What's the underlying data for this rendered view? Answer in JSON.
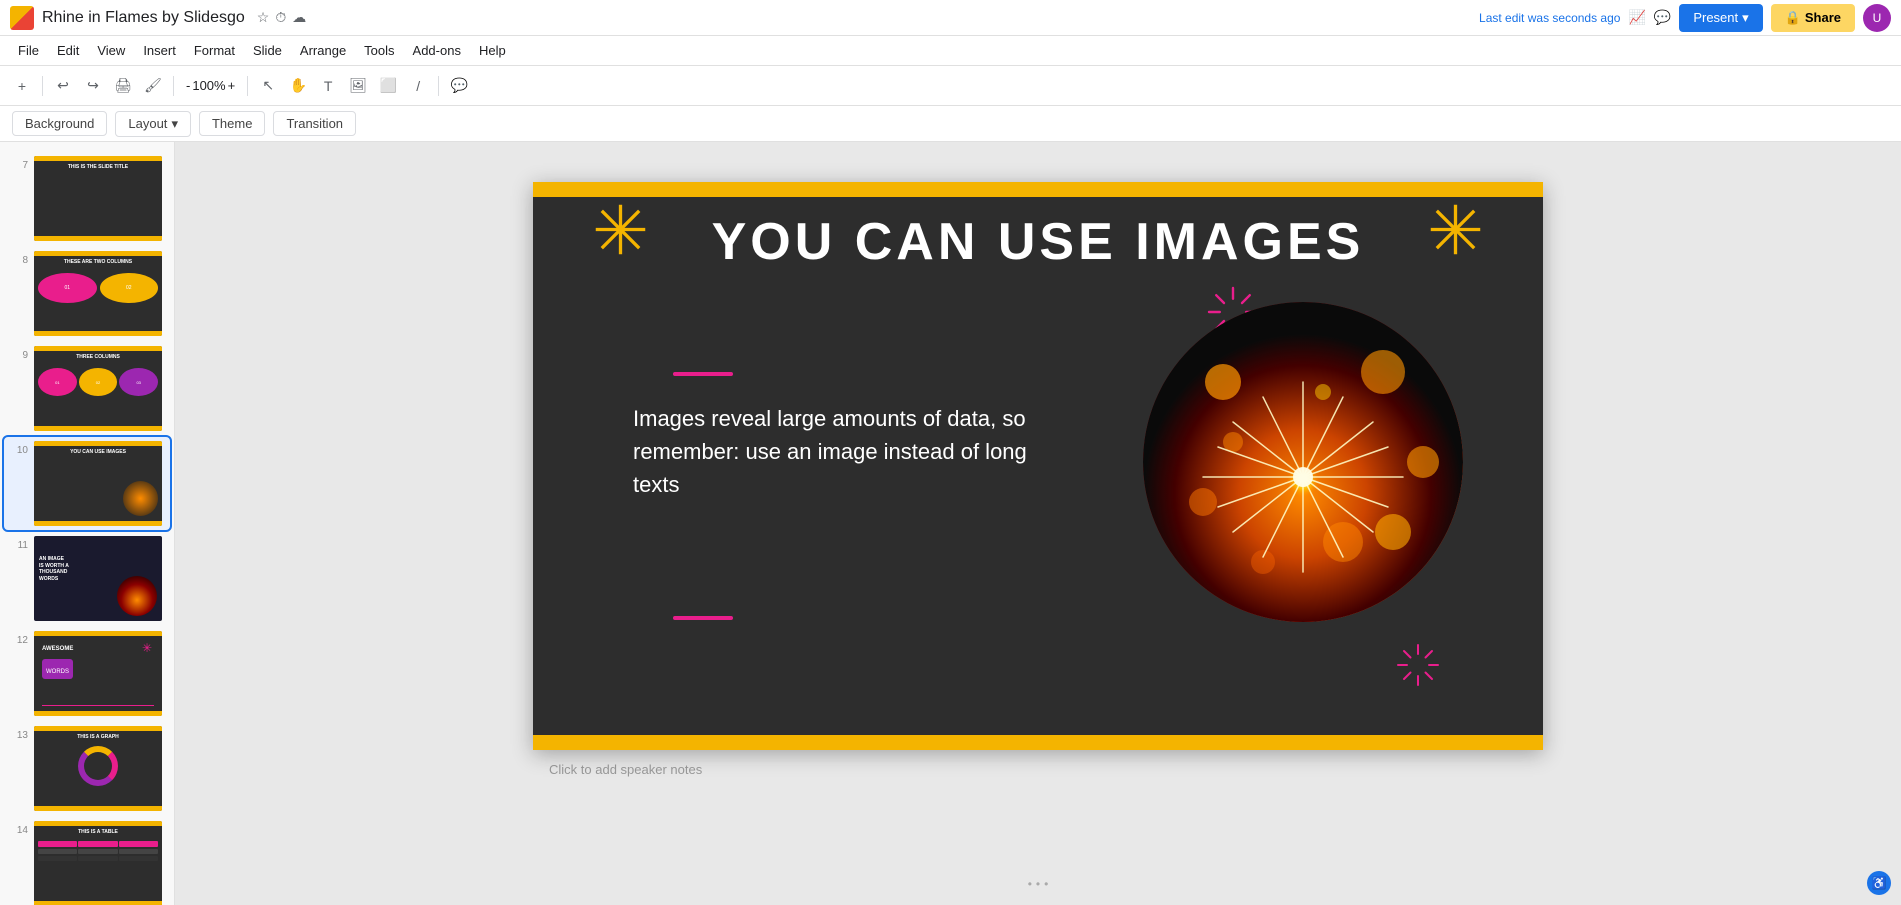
{
  "app": {
    "title": "Rhine in Flames by Slidesgo",
    "logo": "G",
    "last_edit": "Last edit was seconds ago"
  },
  "menu": {
    "items": [
      "File",
      "Edit",
      "View",
      "Insert",
      "Format",
      "Slide",
      "Arrange",
      "Tools",
      "Add-ons",
      "Help"
    ]
  },
  "toolbar": {
    "zoom": "100%",
    "items": [
      "add",
      "undo",
      "redo",
      "print",
      "paint-format",
      "zoom-out",
      "zoom-in",
      "select",
      "hand",
      "text",
      "image",
      "shapes",
      "line",
      "comment"
    ]
  },
  "slide_toolbar": {
    "background": "Background",
    "layout": "Layout",
    "theme": "Theme",
    "transition": "Transition"
  },
  "header": {
    "present_label": "Present",
    "share_label": "Share"
  },
  "sidebar": {
    "slides": [
      {
        "num": "7",
        "type": "title-slide"
      },
      {
        "num": "8",
        "type": "two-columns"
      },
      {
        "num": "9",
        "type": "three-columns"
      },
      {
        "num": "10",
        "type": "image-slide",
        "active": true
      },
      {
        "num": "11",
        "type": "thousand-words"
      },
      {
        "num": "12",
        "type": "awesome-words"
      },
      {
        "num": "13",
        "type": "graph"
      },
      {
        "num": "14",
        "type": "table"
      }
    ]
  },
  "slide": {
    "title": "YOU CAN USE IMAGES",
    "body_text": "Images reveal large amounts of data, so remember: use an image instead of long texts",
    "accent_color": "#f4b400",
    "pink_color": "#e91e8c",
    "bg_color": "#2d2d2d"
  },
  "notes": {
    "placeholder": "Click to add speaker notes"
  },
  "slide_labels": {
    "7": "THIS IS THE SLIDE TITLE",
    "8": "THESE ARE TWO COLUMNS",
    "9": "THREE COLUMNS",
    "10": "YOU CAN USE IMAGES",
    "11": "AN IMAGE IS WORTH A THOUSAND WORDS",
    "12": "AWESOME WORDS",
    "13": "THIS IS A GRAPH",
    "14": "THIS IS A TABLE"
  }
}
